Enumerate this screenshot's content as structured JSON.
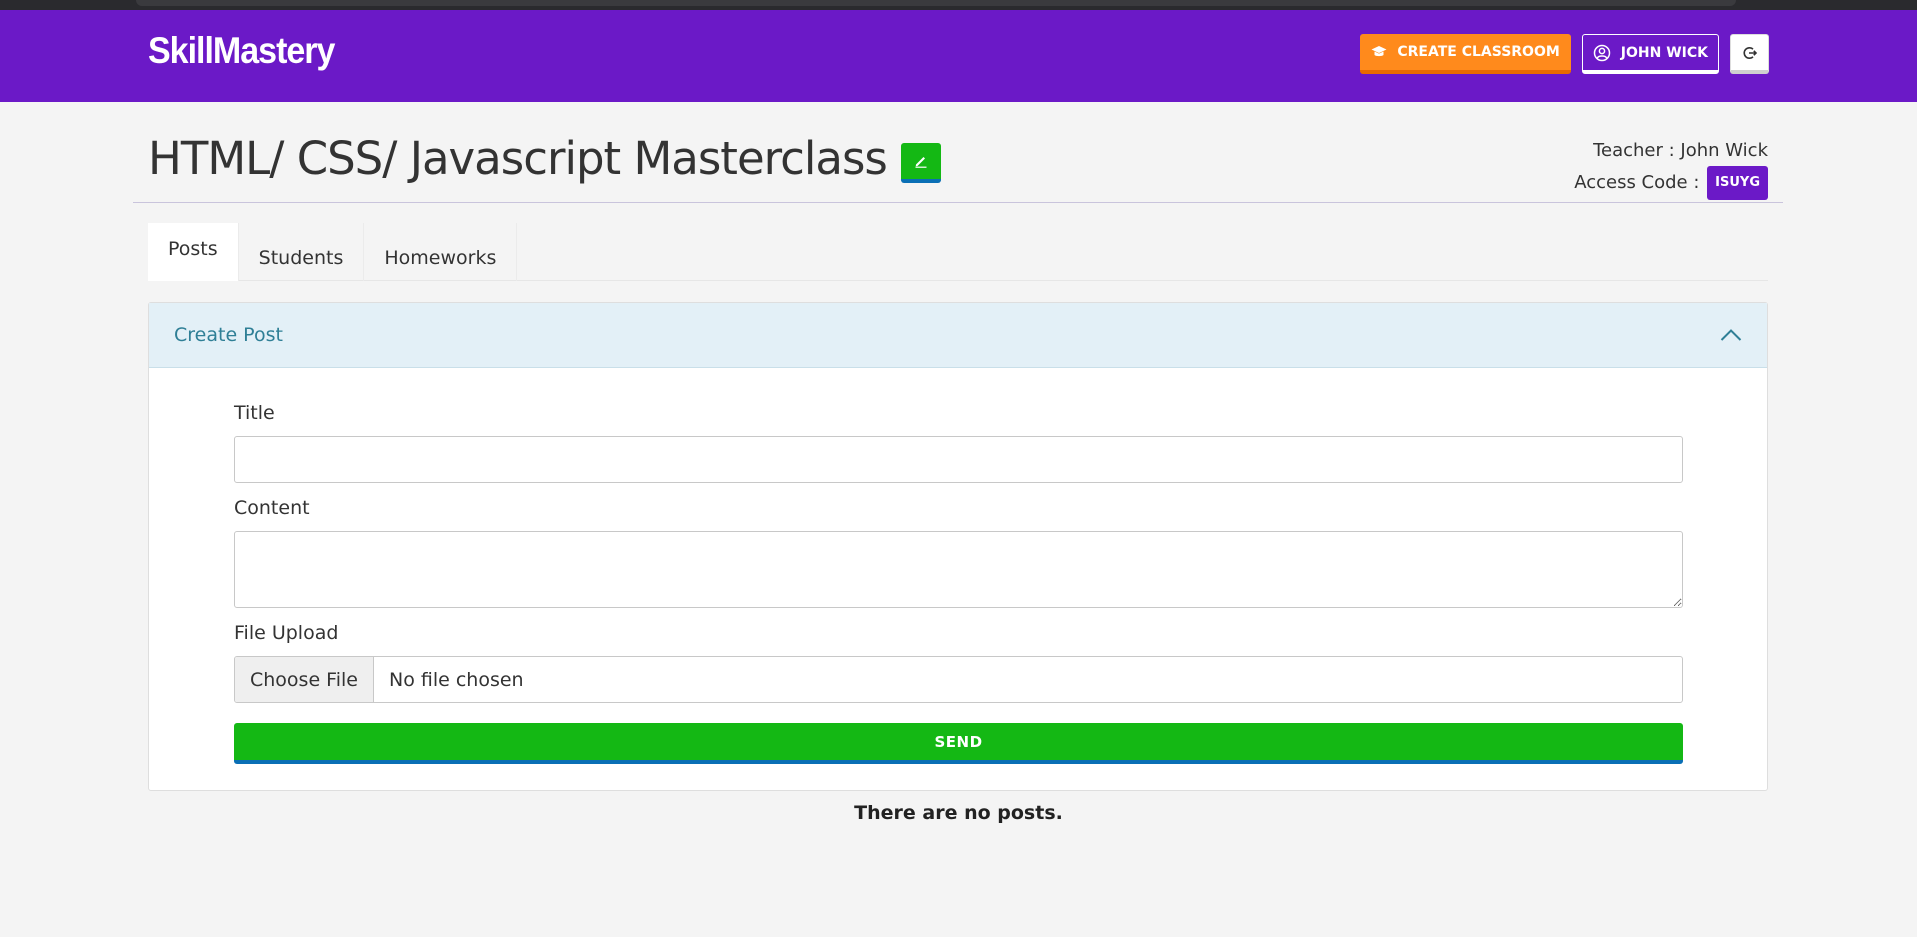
{
  "brand": {
    "name": "SkillMastery"
  },
  "navbar": {
    "create_classroom_label": "CREATE CLASSROOM",
    "user_label": "JOHN WICK",
    "colors": {
      "bg": "#6b19c7",
      "create": "#ff8a1c"
    }
  },
  "classroom": {
    "title": "HTML/ CSS/ Javascript Masterclass",
    "teacher_text": "Teacher : John Wick",
    "access_code_label": "Access Code :",
    "access_code": "ISUYG"
  },
  "tabs": [
    {
      "label": "Posts",
      "active": true
    },
    {
      "label": "Students",
      "active": false
    },
    {
      "label": "Homeworks",
      "active": false
    }
  ],
  "create_post": {
    "header": "Create Post",
    "title_label": "Title",
    "title_value": "",
    "content_label": "Content",
    "content_value": "",
    "file_label": "File Upload",
    "file_button": "Choose File",
    "file_status": "No file chosen",
    "send_label": "SEND"
  },
  "posts": {
    "empty_message": "There are no posts."
  }
}
